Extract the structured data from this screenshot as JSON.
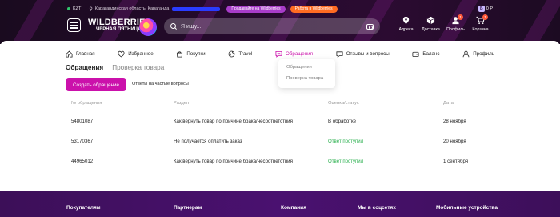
{
  "header": {
    "currency": "KZT",
    "city": "Карагандинская область, Караганда",
    "sell_label": "Продавайте на Wildberries",
    "work_label": "Работа в Wildberries",
    "wallet_badge": "Б",
    "wallet_value": "0 Р",
    "logo_main": "WILDBERRIES",
    "logo_sub": "ЧЕРНАЯ ПЯТНИЦА",
    "search_placeholder": "Я ищу...",
    "icons": [
      {
        "name": "addresses",
        "label": "Адреса",
        "icon": "pin-icon"
      },
      {
        "name": "delivery",
        "label": "Доставка",
        "icon": "box-icon"
      },
      {
        "name": "profile",
        "label": "Профиль",
        "icon": "user-icon",
        "badge": "1"
      },
      {
        "name": "cart",
        "label": "Корзина",
        "icon": "cart-icon",
        "badge": "1"
      }
    ]
  },
  "nav": {
    "items": [
      {
        "label": "Главная",
        "icon": "home-icon"
      },
      {
        "label": "Избранное",
        "icon": "heart-icon"
      },
      {
        "label": "Покупки",
        "icon": "bag-icon"
      },
      {
        "label": "Travel",
        "icon": "globe-icon"
      },
      {
        "label": "Обращения",
        "icon": "chat-icon",
        "active": true
      },
      {
        "label": "Отзывы и вопросы",
        "icon": "comment-icon"
      },
      {
        "label": "Баланс",
        "icon": "wallet-icon"
      },
      {
        "label": "Профиль",
        "icon": "user-icon"
      }
    ],
    "dropdown": [
      "Обращения",
      "Проверка товара"
    ]
  },
  "subtabs": [
    {
      "label": "Обращения",
      "active": true
    },
    {
      "label": "Проверка товара",
      "active": false
    }
  ],
  "create_button": "Создать обращение",
  "faq_link": "Ответы на частые вопросы",
  "table": {
    "headers": [
      "№ обращения",
      "Раздел",
      "Оценка/статус",
      "Дата"
    ],
    "rows": [
      {
        "id": "54801087",
        "section": "Как вернуть товар по причине брака/несоответствия",
        "status": "В обработке",
        "status_color": "#242424",
        "date": "28 ноября"
      },
      {
        "id": "53170367",
        "section": "Не получается оплатить заказ",
        "status": "Ответ поступил",
        "status_color": "#2bb04f",
        "date": "20 ноября"
      },
      {
        "id": "44965012",
        "section": "Как вернуть товар по причине брака/несоответствия",
        "status": "Ответ поступил",
        "status_color": "#2bb04f",
        "date": "1 сентября"
      }
    ]
  },
  "footer": {
    "columns": [
      "Покупателям",
      "Партнерам",
      "Компания",
      "Мы в соцсетях",
      "Мобильные устройства"
    ]
  },
  "colors": {
    "accent": "#cb11ab",
    "success": "#2bb04f",
    "footer_bg": "#4a1170",
    "header_bg": "#260a2d"
  }
}
